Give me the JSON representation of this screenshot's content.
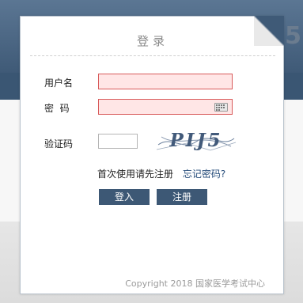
{
  "background": {
    "glyph": "5"
  },
  "login": {
    "title": "登录",
    "username_label": "用户名",
    "username_value": "",
    "password_label": "密  码",
    "password_value": "",
    "keyboard_icon": "virtual-keyboard-icon",
    "captcha_label": "验证码",
    "captcha_value": "",
    "captcha_image_text": "PIJ5",
    "first_use_text": "首次使用请先注册",
    "forgot_link": "忘记密码?",
    "login_button": "登入",
    "register_button": "注册",
    "footer": "Copyright 2018 国家医学考试中心"
  },
  "colors": {
    "brand_dark": "#3d5875",
    "field_error_bg": "#ffe6e6",
    "field_error_border": "#d85a5a",
    "link": "#2a4f7c"
  }
}
